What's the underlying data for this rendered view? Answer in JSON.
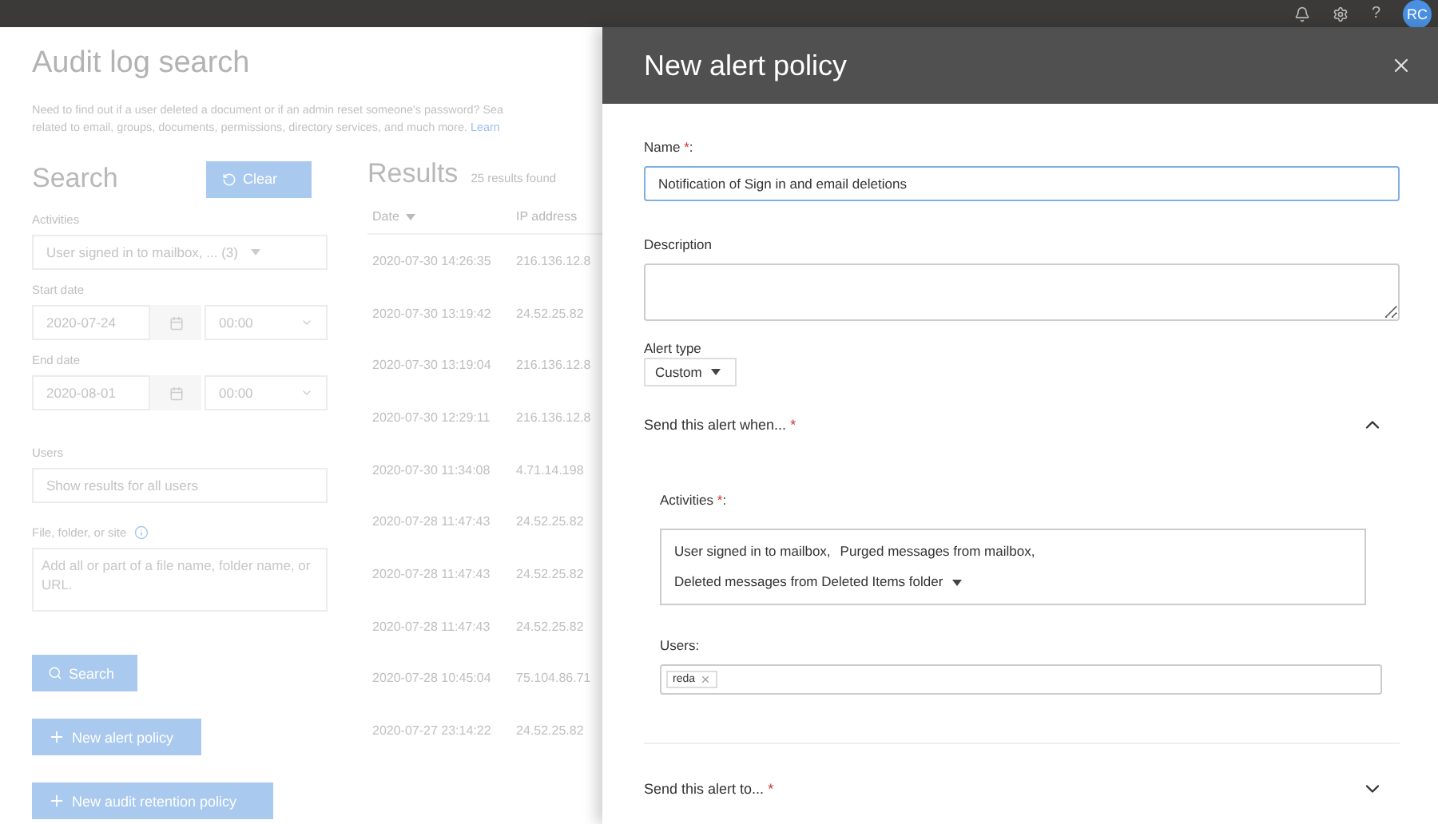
{
  "top_bar": {
    "help": "?",
    "avatar": "RC"
  },
  "audit": {
    "title": "Audit log search",
    "intro_lines": [
      "Need to find out if a user deleted a document or if an admin reset someone's password? Sea",
      "related to email, groups, documents, permissions, directory services, and much more. Learn"
    ],
    "search": {
      "title": "Search",
      "clear_button": "Clear",
      "activities_label": "Activities",
      "activities_value": "User signed in to mailbox, ... (3)",
      "start_date_label": "Start date",
      "start_date": "2020-07-24",
      "start_time": "00:00",
      "end_date_label": "End date",
      "end_date": "2020-08-01",
      "end_time": "00:00",
      "users_label": "Users",
      "users_placeholder": "Show results for all users",
      "file_label": "File, folder, or site",
      "file_placeholder": "Add all or part of a file name, folder name, or URL.",
      "search_button": "Search",
      "new_alert_button": "New alert policy",
      "new_retention_button": "New audit retention policy"
    },
    "results": {
      "title": "Results",
      "count": "25 results found",
      "columns": [
        "Date",
        "IP address"
      ],
      "rows": [
        {
          "date": "2020-07-30 14:26:35",
          "ip": "216.136.12.8"
        },
        {
          "date": "2020-07-30 13:19:42",
          "ip": "24.52.25.82"
        },
        {
          "date": "2020-07-30 13:19:04",
          "ip": "216.136.12.8"
        },
        {
          "date": "2020-07-30 12:29:11",
          "ip": "216.136.12.8"
        },
        {
          "date": "2020-07-30 11:34:08",
          "ip": "4.71.14.198"
        },
        {
          "date": "2020-07-28 11:47:43",
          "ip": "24.52.25.82"
        },
        {
          "date": "2020-07-28 11:47:43",
          "ip": "24.52.25.82"
        },
        {
          "date": "2020-07-28 11:47:43",
          "ip": "24.52.25.82"
        },
        {
          "date": "2020-07-28 10:45:04",
          "ip": "75.104.86.71"
        },
        {
          "date": "2020-07-27 23:14:22",
          "ip": "24.52.25.82"
        }
      ]
    }
  },
  "panel": {
    "title": "New alert policy",
    "name_label": {
      "text": "Name",
      "mark": "*",
      "suffix": ":"
    },
    "name_value": "Notification of Sign in and email deletions",
    "description_label": "Description",
    "alert_type_label": "Alert type",
    "alert_type": "Custom",
    "sections": [
      {
        "title": "Send this alert when...",
        "mark": "*",
        "expanded": true,
        "activities_label": {
          "text": "Activities",
          "mark": "*",
          "suffix": ":"
        },
        "activities": [
          "User signed in to mailbox,",
          "Purged messages from mailbox,",
          "Deleted messages from Deleted Items folder"
        ],
        "users_label": "Users:",
        "users": [
          "reda"
        ]
      },
      {
        "title": "Send this alert to...",
        "mark": "*",
        "expanded": false
      }
    ]
  }
}
